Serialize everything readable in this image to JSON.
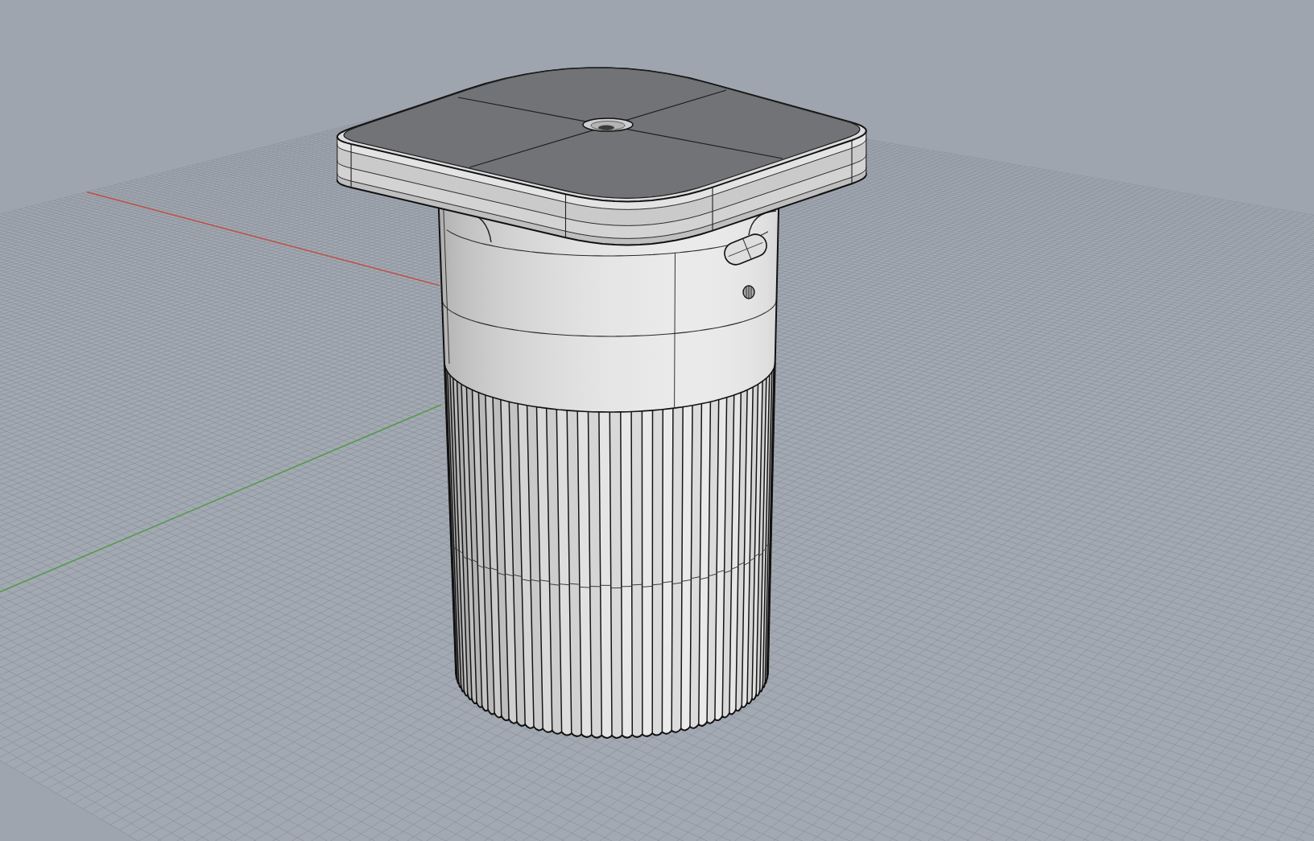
{
  "viewport": {
    "axes": [
      {
        "color": "#b9564f"
      },
      {
        "color": "#5a9a52"
      }
    ]
  }
}
